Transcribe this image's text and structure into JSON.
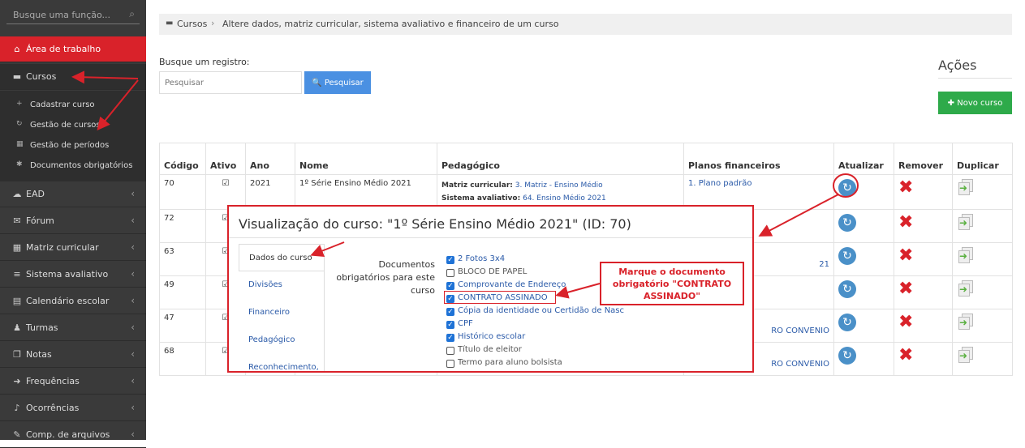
{
  "sidebar": {
    "search_placeholder": "Busque uma função...",
    "items": [
      {
        "label": "Área de trabalho",
        "icon": "home-icon",
        "glyph": "⌂"
      },
      {
        "label": "Cursos",
        "icon": "folder-icon",
        "glyph": "▬"
      },
      {
        "label": "EAD",
        "icon": "cloud-icon",
        "glyph": "☁"
      },
      {
        "label": "Fórum",
        "icon": "comments-icon",
        "glyph": "✉"
      },
      {
        "label": "Matriz curricular",
        "icon": "table-icon",
        "glyph": "▦"
      },
      {
        "label": "Sistema avaliativo",
        "icon": "list-icon",
        "glyph": "≡"
      },
      {
        "label": "Calendário escolar",
        "icon": "calendar-icon",
        "glyph": "▤"
      },
      {
        "label": "Turmas",
        "icon": "users-icon",
        "glyph": "♟"
      },
      {
        "label": "Notas",
        "icon": "copy-icon",
        "glyph": "❐"
      },
      {
        "label": "Frequências",
        "icon": "sign-in-icon",
        "glyph": "➜"
      },
      {
        "label": "Ocorrências",
        "icon": "bell-icon",
        "glyph": "♪"
      },
      {
        "label": "Comp. de arquivos",
        "icon": "paperclip-icon",
        "glyph": "✎"
      }
    ],
    "submenu": [
      {
        "label": "Cadastrar curso",
        "icon": "plus-icon",
        "glyph": "+"
      },
      {
        "label": "Gestão de cursos",
        "icon": "refresh-icon",
        "glyph": "↻"
      },
      {
        "label": "Gestão de períodos",
        "icon": "calendar-icon",
        "glyph": "▦"
      },
      {
        "label": "Documentos obrigatórios",
        "icon": "asterisk-icon",
        "glyph": "✱"
      }
    ]
  },
  "breadcrumb": {
    "root": "Cursos",
    "separator": "›",
    "current": "Altere dados, matriz curricular, sistema avaliativo e financeiro de um curso"
  },
  "search": {
    "label": "Busque um registro:",
    "placeholder": "Pesquisar",
    "button": "🔍 Pesquisar"
  },
  "actions": {
    "title": "Ações",
    "new_button": "✚ Novo curso"
  },
  "table": {
    "headers": [
      "Código",
      "Ativo",
      "Ano",
      "Nome",
      "Pedagógico",
      "Planos financeiros",
      "Atualizar",
      "Remover",
      "Duplicar"
    ],
    "rows": [
      {
        "codigo": "70",
        "ativo": "☑",
        "ano": "2021",
        "nome": "1º Série Ensino Médio 2021",
        "ped_matriz_label": "Matriz curricular:",
        "ped_matriz": "3. Matriz - Ensino Médio",
        "ped_sistema_label": "Sistema avaliativo:",
        "ped_sistema": "64. Ensino Médio 2021",
        "planos": "1. Plano padrão"
      },
      {
        "codigo": "72",
        "ativo": "☑",
        "planos": ""
      },
      {
        "codigo": "63",
        "ativo": "☑",
        "planos": "21"
      },
      {
        "codigo": "49",
        "ativo": "☑",
        "planos": ""
      },
      {
        "codigo": "47",
        "ativo": "☑",
        "planos": "RO CONVENIO"
      },
      {
        "codigo": "68",
        "ativo": "☑",
        "planos": "RO CONVENIO"
      }
    ]
  },
  "modal": {
    "title": "Visualização do curso: \"1º Série Ensino Médio 2021\" (ID: 70)",
    "tabs": [
      "Dados do curso",
      "Divisões",
      "Financeiro",
      "Pedagógico",
      "Reconhecimento,"
    ],
    "docs_label": "Documentos obrigatórios para este curso",
    "documents": [
      {
        "label": "2 Fotos 3x4",
        "checked": true
      },
      {
        "label": "BLOCO DE PAPEL",
        "checked": false
      },
      {
        "label": "Comprovante de Endereço",
        "checked": true
      },
      {
        "label": "CONTRATO ASSINADO",
        "checked": true
      },
      {
        "label": "Cópia da identidade ou Certidão de Nasc",
        "checked": true
      },
      {
        "label": "CPF",
        "checked": true
      },
      {
        "label": "Histórico escolar",
        "checked": true
      },
      {
        "label": "Título de eleitor",
        "checked": false
      },
      {
        "label": "Termo para aluno bolsista",
        "checked": false
      }
    ]
  },
  "callout": {
    "text": "Marque o documento obrigatório \"CONTRATO ASSINADO\""
  },
  "colors": {
    "accent": "#d9222a",
    "sidebar_bg": "#3a3a3a",
    "primary": "#4a90e2",
    "success": "#2eaa4a"
  }
}
